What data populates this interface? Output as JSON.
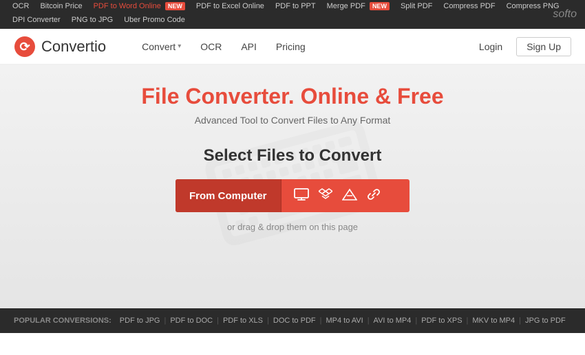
{
  "topbar": {
    "row1": [
      {
        "label": "OCR",
        "active": false
      },
      {
        "label": "Bitcoin Price",
        "active": false
      },
      {
        "label": "PDF to Word Online",
        "active": true,
        "badge": "NEW"
      },
      {
        "label": "PDF to Excel Online",
        "active": false
      },
      {
        "label": "PDF to PPT",
        "active": false
      },
      {
        "label": "Merge PDF",
        "active": false,
        "badge": "NEW"
      },
      {
        "label": "Split PDF",
        "active": false
      },
      {
        "label": "Compress PDF",
        "active": false
      },
      {
        "label": "Compress PNG",
        "active": false
      }
    ],
    "row2": [
      {
        "label": "DPI Converter",
        "active": false
      },
      {
        "label": "PNG to JPG",
        "active": false
      },
      {
        "label": "Uber Promo Code",
        "active": false
      }
    ],
    "softo": "softo"
  },
  "nav": {
    "logo_text": "Convertio",
    "convert_label": "Convert",
    "ocr_label": "OCR",
    "api_label": "API",
    "pricing_label": "Pricing",
    "login_label": "Login",
    "signup_label": "Sign Up"
  },
  "hero": {
    "title": "File Converter. Online & Free",
    "subtitle": "Advanced Tool to Convert Files to Any Format",
    "select_title": "Select Files to Convert",
    "from_computer": "From Computer",
    "drag_drop": "or drag & drop them on this page"
  },
  "footer": {
    "popular_label": "POPULAR CONVERSIONS:",
    "links": [
      "PDF to JPG",
      "PDF to DOC",
      "PDF to XLS",
      "DOC to PDF",
      "MP4 to AVI",
      "AVI to MP4",
      "PDF to XPS",
      "MKV to MP4",
      "JPG to PDF"
    ]
  }
}
